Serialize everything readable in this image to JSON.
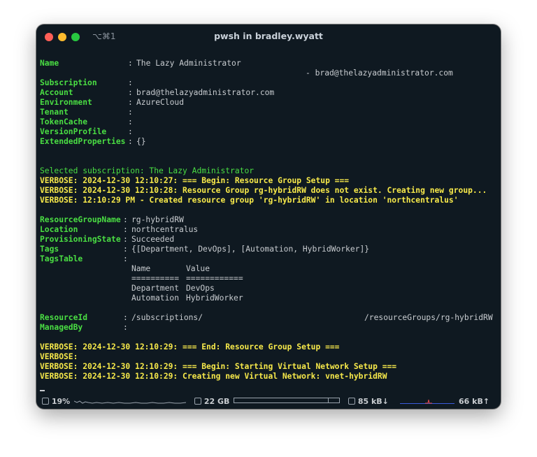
{
  "window": {
    "shortcut": "⌥⌘1",
    "title": "pwsh in bradley.wyatt"
  },
  "context": {
    "name_label": "Name",
    "name_value": "The Lazy Administrator",
    "name_cont": "- brad@thelazyadministrator.com",
    "subscription_label": "Subscription",
    "account_label": "Account",
    "account_value": "brad@thelazyadministrator.com",
    "environment_label": "Environment",
    "environment_value": "AzureCloud",
    "tenant_label": "Tenant",
    "tokencache_label": "TokenCache",
    "versionprofile_label": "VersionProfile",
    "extended_label": "ExtendedProperties",
    "extended_value": "{}",
    "separator": ":"
  },
  "selected_subscription": "Selected subscription: The Lazy Administrator",
  "verbose_1": [
    "VERBOSE: 2024-12-30 12:10:27: === Begin: Resource Group Setup ===",
    "VERBOSE: 2024-12-30 12:10:28: Resource Group rg-hybridRW does not exist. Creating new group...",
    "VERBOSE: 12:10:29 PM - Created resource group 'rg-hybridRW' in location 'northcentralus'"
  ],
  "rg": {
    "name_label": "ResourceGroupName",
    "name_value": "rg-hybridRW",
    "location_label": "Location",
    "location_value": "northcentralus",
    "state_label": "ProvisioningState",
    "state_value": "Succeeded",
    "tags_label": "Tags",
    "tags_value": "{[Department, DevOps], [Automation, HybridWorker]}",
    "tagstable_label": "TagsTable",
    "table_header_name": "Name",
    "table_header_value": "Value",
    "table_rule_name": "==========",
    "table_rule_value": "============",
    "rows": [
      {
        "name": "Department",
        "value": "DevOps"
      },
      {
        "name": "Automation",
        "value": "HybridWorker"
      }
    ],
    "resourceid_label": "ResourceId",
    "resourceid_left": "/subscriptions/",
    "resourceid_right": "/resourceGroups/rg-hybridRW",
    "managedby_label": "ManagedBy"
  },
  "verbose_2": [
    "VERBOSE: 2024-12-30 12:10:29: === End: Resource Group Setup ===",
    "VERBOSE:",
    "VERBOSE: 2024-12-30 12:10:29: === Begin: Starting Virtual Network Setup ===",
    "VERBOSE: 2024-12-30 12:10:29: Creating new Virtual Network: vnet-hybridRW"
  ],
  "status": {
    "cpu": "19%",
    "memory": "22 GB",
    "net_down": "85 kB↓",
    "net_up": "66 kB↑"
  },
  "colors": {
    "background": "#0f1921",
    "key_green": "#4ade43",
    "verbose_yellow": "#f7e94a",
    "text": "#c8ccd0"
  }
}
